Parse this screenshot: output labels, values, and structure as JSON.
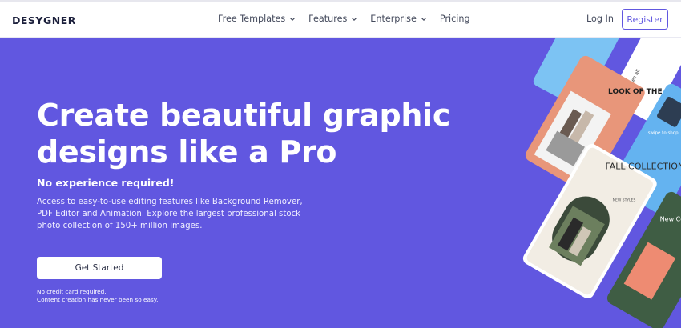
{
  "brand": {
    "name": "DESYGNER"
  },
  "nav": {
    "items": [
      {
        "label": "Free Templates",
        "dropdown": true
      },
      {
        "label": "Features",
        "dropdown": true
      },
      {
        "label": "Enterprise",
        "dropdown": true
      },
      {
        "label": "Pricing",
        "dropdown": false
      }
    ],
    "login": "Log In",
    "register": "Register"
  },
  "hero": {
    "headline": "Create beautiful graphic designs like a Pro",
    "subheading": "No experience required!",
    "description": "Access to easy-to-use editing features like Background Remover, PDF Editor and Animation. Explore the largest professional stock photo collection of 150+ million images.",
    "cta": "Get Started",
    "note_line1": "No credit card required.",
    "note_line2": "Content creation has never been so easy."
  },
  "showcase": {
    "card_orange_title": "LOOK OF THE DAY",
    "card_fall_title": "FALL COLLECTION",
    "card_fall_sub": "NEW STYLES",
    "card_blue_text": "swipe to shop",
    "card_white_text": "see all",
    "card_green_text": "New Coll"
  },
  "colors": {
    "brand_purple": "#6157e0",
    "card_orange": "#e8967a",
    "card_blue": "#64b3f0",
    "card_green": "#3f5d44"
  }
}
